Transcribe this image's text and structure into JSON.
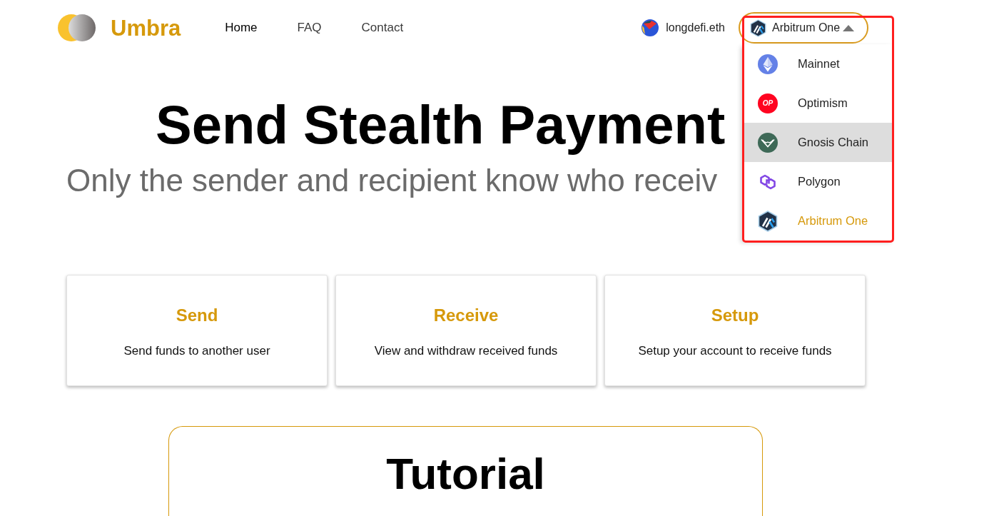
{
  "header": {
    "logo_text": "Umbra",
    "nav": [
      {
        "label": "Home",
        "selected": true
      },
      {
        "label": "FAQ",
        "selected": false
      },
      {
        "label": "Contact",
        "selected": false
      }
    ],
    "account": "longdefi.eth",
    "network_button": {
      "label": "Arbitrum One",
      "expanded": true
    }
  },
  "network_menu": {
    "items": [
      {
        "label": "Mainnet",
        "selected": false,
        "highlighted": false
      },
      {
        "label": "Optimism",
        "selected": false,
        "highlighted": false,
        "logo_text": "OP"
      },
      {
        "label": "Gnosis Chain",
        "selected": false,
        "highlighted": true
      },
      {
        "label": "Polygon",
        "selected": false,
        "highlighted": false
      },
      {
        "label": "Arbitrum One",
        "selected": true,
        "highlighted": false
      }
    ]
  },
  "hero": {
    "title": "Send Stealth Payment",
    "subtitle": "Only the sender and recipient know who receiv"
  },
  "cards": [
    {
      "title": "Send",
      "description": "Send funds to another user"
    },
    {
      "title": "Receive",
      "description": "View and withdraw received funds"
    },
    {
      "title": "Setup",
      "description": "Setup your account to receive funds"
    }
  ],
  "tutorial": {
    "title": "Tutorial"
  }
}
